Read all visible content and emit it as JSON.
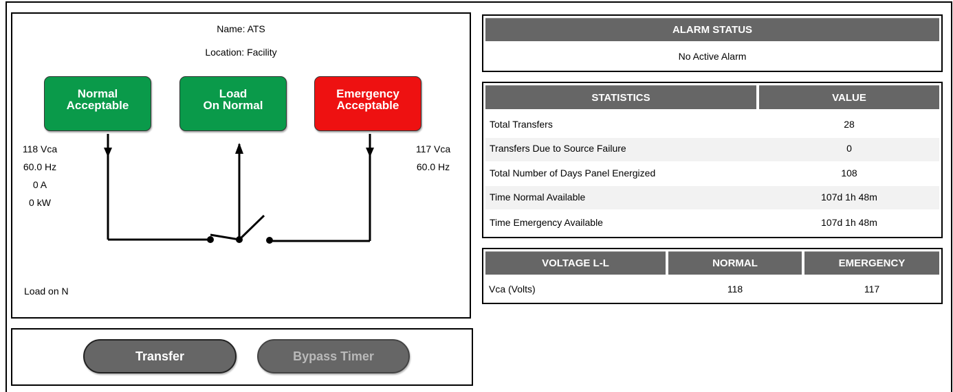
{
  "unit": {
    "name_line": "Name: ATS",
    "location_line": "Location: Facility"
  },
  "status_boxes": [
    {
      "line1": "Normal",
      "line2": "Acceptable",
      "color": "#0a9a4a"
    },
    {
      "line1": "Load",
      "line2": "On Normal",
      "color": "#0a9a4a"
    },
    {
      "line1": "Emergency",
      "line2": "Acceptable",
      "color": "#ee1111"
    }
  ],
  "normal_source": {
    "voltage": "118 Vca",
    "frequency": "60.0 Hz",
    "current": "0 A",
    "power": "0 kW"
  },
  "emergency_source": {
    "voltage": "117 Vca",
    "frequency": "60.0 Hz"
  },
  "load_status": "Load on N",
  "controls": {
    "transfer_label": "Transfer",
    "bypass_label": "Bypass Timer"
  },
  "alarm": {
    "header": "ALARM STATUS",
    "message": "No Active Alarm"
  },
  "statistics": {
    "headers": [
      "STATISTICS",
      "VALUE"
    ],
    "rows": [
      {
        "label": "Total Transfers",
        "value": "28"
      },
      {
        "label": "Transfers Due to Source Failure",
        "value": "0"
      },
      {
        "label": "Total Number of Days Panel Energized",
        "value": "108"
      },
      {
        "label": "Time Normal Available",
        "value": "107d 1h 48m"
      },
      {
        "label": "Time Emergency Available",
        "value": "107d 1h 48m"
      }
    ]
  },
  "voltage": {
    "headers": [
      "VOLTAGE L-L",
      "NORMAL",
      "EMERGENCY"
    ],
    "rows": [
      {
        "label": "Vca (Volts)",
        "normal": "118",
        "emergency": "117"
      }
    ]
  },
  "colors": {
    "header_gray": "#666666",
    "ok_green": "#0a9a4a",
    "alert_red": "#ee1111"
  }
}
